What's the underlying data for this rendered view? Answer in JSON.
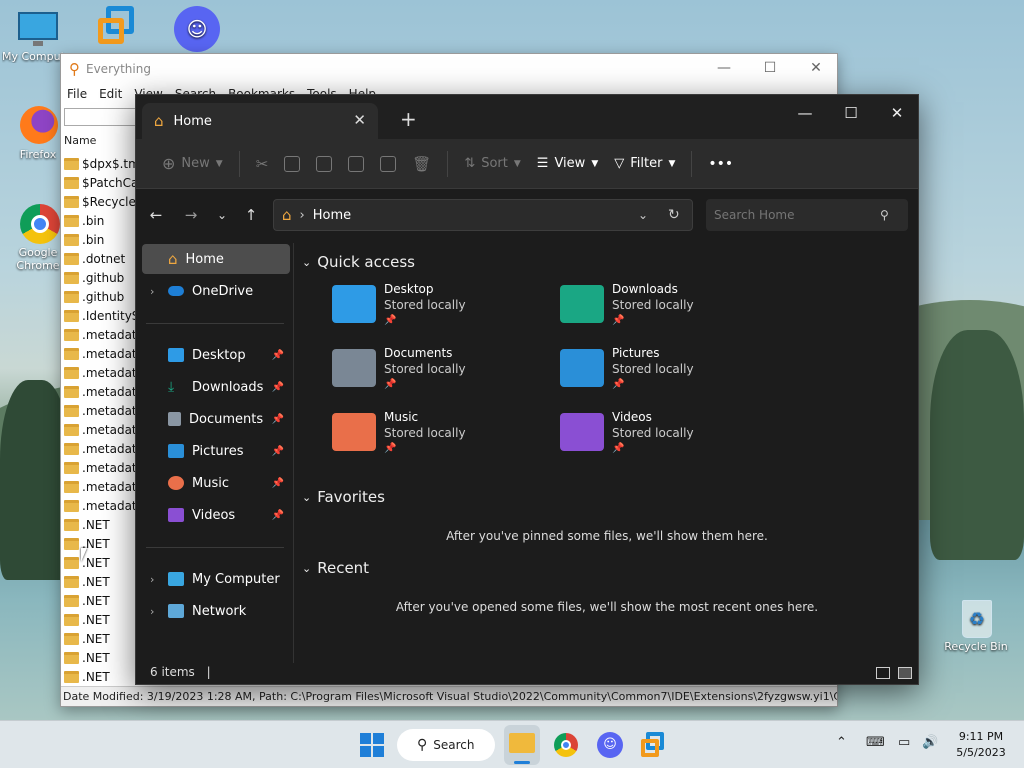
{
  "desktop": {
    "icons": [
      {
        "label": "My Computer"
      },
      {
        "label": ""
      },
      {
        "label": ""
      },
      {
        "label": "Firefox"
      },
      {
        "label": "Google Chrome"
      },
      {
        "label": "Recycle Bin"
      }
    ]
  },
  "everything": {
    "title": "Everything",
    "menu": [
      "File",
      "Edit",
      "View",
      "Search",
      "Bookmarks",
      "Tools",
      "Help"
    ],
    "column_header": "Name",
    "rows": [
      "$dpx$.tmp",
      "$PatchCache$",
      "$Recycle.Bin",
      ".bin",
      ".bin",
      ".dotnet",
      ".github",
      ".github",
      ".IdentityService",
      ".metadata",
      ".metadata",
      ".metadata",
      ".metadata",
      ".metadata",
      ".metadata",
      ".metadata",
      ".metadata",
      ".metadata",
      ".metadata",
      ".NET",
      ".NET",
      ".NET",
      ".NET",
      ".NET",
      ".NET",
      ".NET",
      ".NET",
      ".NET"
    ],
    "status": "Date Modified: 3/19/2023 1:28 AM, Path: C:\\Program Files\\Microsoft Visual Studio\\2022\\Community\\Common7\\IDE\\Extensions\\2fyzgwsw.yi1\\ConsoleApplicati"
  },
  "explorer": {
    "tab_title": "Home",
    "toolbar": {
      "new": "New",
      "sort": "Sort",
      "view": "View",
      "filter": "Filter",
      "more": "•••"
    },
    "address": "Home",
    "search_placeholder": "Search Home",
    "sidebar": {
      "home": "Home",
      "onedrive": "OneDrive",
      "desktop": "Desktop",
      "downloads": "Downloads",
      "documents": "Documents",
      "pictures": "Pictures",
      "music": "Music",
      "videos": "Videos",
      "mycomputer": "My Computer",
      "network": "Network"
    },
    "sections": {
      "quick_access": "Quick access",
      "favorites": "Favorites",
      "recent": "Recent"
    },
    "quick_access": [
      {
        "name": "Desktop",
        "sub": "Stored locally",
        "color": "#2e9be6"
      },
      {
        "name": "Downloads",
        "sub": "Stored locally",
        "color": "#1aa784"
      },
      {
        "name": "Documents",
        "sub": "Stored locally",
        "color": "#7a8795"
      },
      {
        "name": "Pictures",
        "sub": "Stored locally",
        "color": "#2a8fd8"
      },
      {
        "name": "Music",
        "sub": "Stored locally",
        "color": "#e96f4a"
      },
      {
        "name": "Videos",
        "sub": "Stored locally",
        "color": "#8a4fd3"
      }
    ],
    "favorites_msg": "After you've pinned some files, we'll show them here.",
    "recent_msg": "After you've opened some files, we'll show the most recent ones here.",
    "status": "6 items"
  },
  "taskbar": {
    "search_label": "Search",
    "clock_time": "9:11 PM",
    "clock_date": "5/5/2023"
  }
}
